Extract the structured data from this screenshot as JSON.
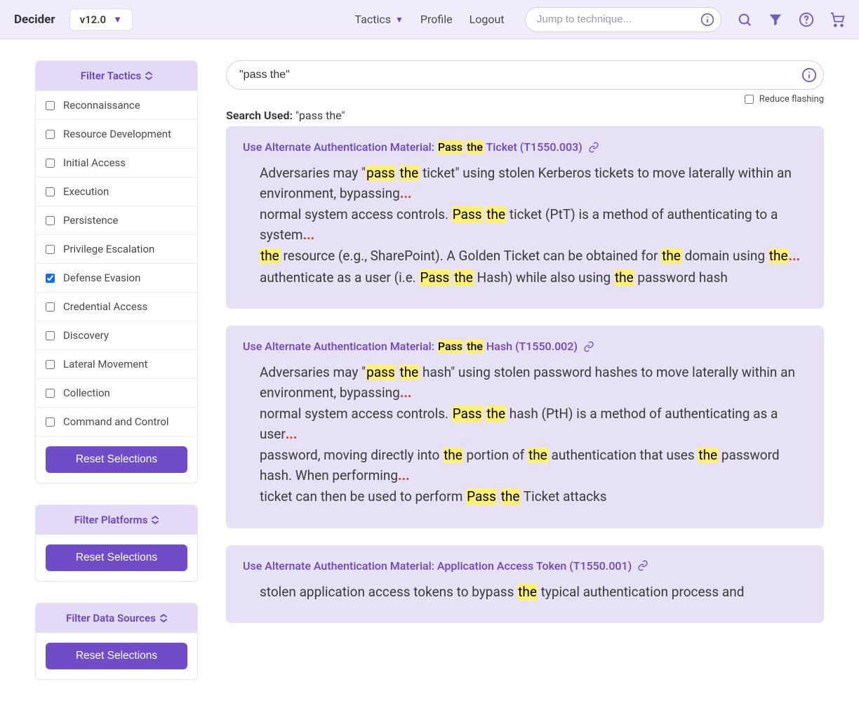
{
  "header": {
    "brand": "Decider",
    "version": "v12.0",
    "tactics_label": "Tactics",
    "profile_label": "Profile",
    "logout_label": "Logout",
    "jump_placeholder": "Jump to technique..."
  },
  "sidebar": {
    "panels": [
      {
        "title": "Filter Tactics",
        "reset": "Reset Selections",
        "items": [
          {
            "label": "Reconnaissance",
            "checked": false
          },
          {
            "label": "Resource Development",
            "checked": false
          },
          {
            "label": "Initial Access",
            "checked": false
          },
          {
            "label": "Execution",
            "checked": false
          },
          {
            "label": "Persistence",
            "checked": false
          },
          {
            "label": "Privilege Escalation",
            "checked": false
          },
          {
            "label": "Defense Evasion",
            "checked": true
          },
          {
            "label": "Credential Access",
            "checked": false
          },
          {
            "label": "Discovery",
            "checked": false
          },
          {
            "label": "Lateral Movement",
            "checked": false
          },
          {
            "label": "Collection",
            "checked": false
          },
          {
            "label": "Command and Control",
            "checked": false
          }
        ]
      },
      {
        "title": "Filter Platforms",
        "reset": "Reset Selections",
        "items": []
      },
      {
        "title": "Filter Data Sources",
        "reset": "Reset Selections",
        "items": []
      }
    ]
  },
  "search": {
    "query": "\"pass the\"",
    "used_label": "Search Used:",
    "used_value": "\"pass the\"",
    "reduce_flashing": "Reduce flashing"
  },
  "results": [
    {
      "title": {
        "prefix": "Use Alternate Authentication Material: ",
        "hl1": "Pass",
        "sep1": " ",
        "hl2": "the",
        "suffix": " Ticket (T1550.003)"
      },
      "lines": [
        {
          "segments": [
            {
              "t": "Adversaries may \""
            },
            {
              "t": "pass",
              "hl": true
            },
            {
              "t": " "
            },
            {
              "t": "the",
              "hl": true
            },
            {
              "t": " ticket\" using stolen Kerberos tickets to move laterally within an environment, bypassing"
            },
            {
              "t": "...",
              "el": true
            }
          ]
        },
        {
          "segments": [
            {
              "t": "normal system access controls. "
            },
            {
              "t": "Pass",
              "hl": true
            },
            {
              "t": " "
            },
            {
              "t": "the",
              "hl": true
            },
            {
              "t": " ticket (PtT) is a method of authenticating to a system"
            },
            {
              "t": "...",
              "el": true
            }
          ]
        },
        {
          "segments": [
            {
              "t": "the",
              "hl": true
            },
            {
              "t": " resource (e.g., SharePoint). A Golden Ticket can be obtained for "
            },
            {
              "t": "the",
              "hl": true
            },
            {
              "t": " domain using "
            },
            {
              "t": "the",
              "hl": true
            },
            {
              "t": "...",
              "el": true
            }
          ]
        },
        {
          "segments": [
            {
              "t": "authenticate as a user (i.e. "
            },
            {
              "t": "Pass",
              "hl": true
            },
            {
              "t": " "
            },
            {
              "t": "the",
              "hl": true
            },
            {
              "t": " Hash) while also using "
            },
            {
              "t": "the",
              "hl": true
            },
            {
              "t": " password hash"
            }
          ]
        }
      ]
    },
    {
      "title": {
        "prefix": "Use Alternate Authentication Material: ",
        "hl1": "Pass",
        "sep1": " ",
        "hl2": "the",
        "suffix": " Hash (T1550.002)"
      },
      "lines": [
        {
          "segments": [
            {
              "t": "Adversaries may \""
            },
            {
              "t": "pass",
              "hl": true
            },
            {
              "t": " "
            },
            {
              "t": "the",
              "hl": true
            },
            {
              "t": " hash\" using stolen password hashes to move laterally within an environment, bypassing"
            },
            {
              "t": "...",
              "el": true
            }
          ]
        },
        {
          "segments": [
            {
              "t": "normal system access controls. "
            },
            {
              "t": "Pass",
              "hl": true
            },
            {
              "t": " "
            },
            {
              "t": "the",
              "hl": true
            },
            {
              "t": " hash (PtH) is a method of authenticating as a user"
            },
            {
              "t": "...",
              "el": true
            }
          ]
        },
        {
          "segments": [
            {
              "t": "password, moving directly into "
            },
            {
              "t": "the",
              "hl": true
            },
            {
              "t": " portion of "
            },
            {
              "t": "the",
              "hl": true
            },
            {
              "t": " authentication that uses "
            },
            {
              "t": "the",
              "hl": true
            },
            {
              "t": " password hash. When performing"
            },
            {
              "t": "...",
              "el": true
            }
          ]
        },
        {
          "segments": [
            {
              "t": "ticket can then be used to perform "
            },
            {
              "t": "Pass",
              "hl": true
            },
            {
              "t": " "
            },
            {
              "t": "the",
              "hl": true
            },
            {
              "t": " Ticket attacks"
            }
          ]
        }
      ]
    },
    {
      "title": {
        "prefix": "Use Alternate Authentication Material: Application Access Token (T1550.001)",
        "hl1": "",
        "sep1": "",
        "hl2": "",
        "suffix": ""
      },
      "lines": [
        {
          "segments": [
            {
              "t": "stolen application access tokens to bypass "
            },
            {
              "t": "the",
              "hl": true
            },
            {
              "t": " typical authentication process and"
            }
          ]
        }
      ]
    }
  ]
}
